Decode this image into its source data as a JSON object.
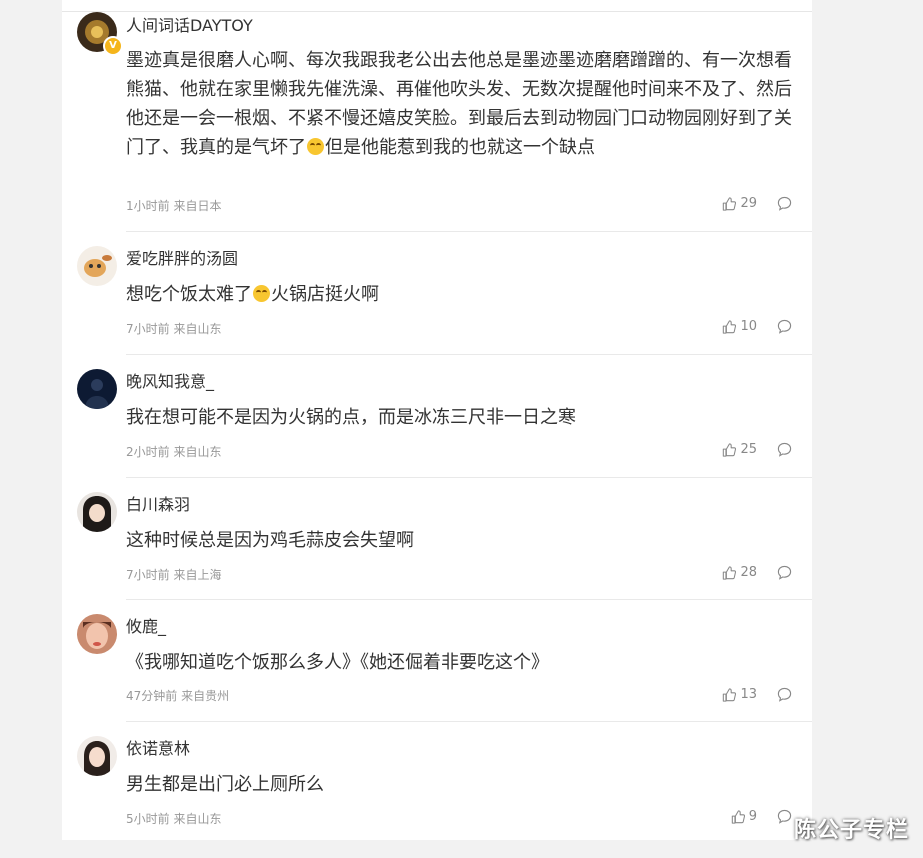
{
  "comments": [
    {
      "username": "人间词话DAYTOY",
      "verified_badge": "V",
      "text": "墨迹真是很磨人心啊、每次我跟我老公出去他总是墨迹墨迹磨磨蹭蹭的、有一次想看熊猫、他就在家里懒我先催洗澡、再催他吹头发、无数次提醒他时间来不及了、然后他还是一会一根烟、不紧不慢还嬉皮笑脸。到最后去到动物园门口动物园刚好到了关门了、我真的是气坏了",
      "text_after_emoji": "但是他能惹到我的也就这一个缺点",
      "meta": "1小时前 来自日本",
      "likes": "29"
    },
    {
      "username": "爱吃胖胖的汤圆",
      "text": "想吃个饭太难了",
      "text_after_emoji": "火锅店挺火啊",
      "meta": "7小时前 来自山东",
      "likes": "10"
    },
    {
      "username": "晚风知我意_",
      "text": "我在想可能不是因为火锅的点，而是冰冻三尺非一日之寒",
      "meta": "2小时前 来自山东",
      "likes": "25"
    },
    {
      "username": "白川森羽",
      "text": "这种时候总是因为鸡毛蒜皮会失望啊",
      "meta": "7小时前 来自上海",
      "likes": "28"
    },
    {
      "username": "攸鹿_",
      "text": "《我哪知道吃个饭那么多人》《她还倔着非要吃这个》",
      "meta": "47分钟前 来自贵州",
      "likes": "13"
    },
    {
      "username": "依诺意林",
      "text": "男生都是出门必上厕所么",
      "meta": "5小时前 来自山东",
      "likes": "9"
    }
  ],
  "watermark": "陈公子专栏",
  "colors": {
    "username": "#333333",
    "text": "#333333",
    "meta": "#999999",
    "badge": "#f5b51b"
  },
  "icons": {
    "like": "thumbs-up-icon",
    "comment": "comment-bubble-icon",
    "emoji": "laughing-tears-emoji"
  }
}
